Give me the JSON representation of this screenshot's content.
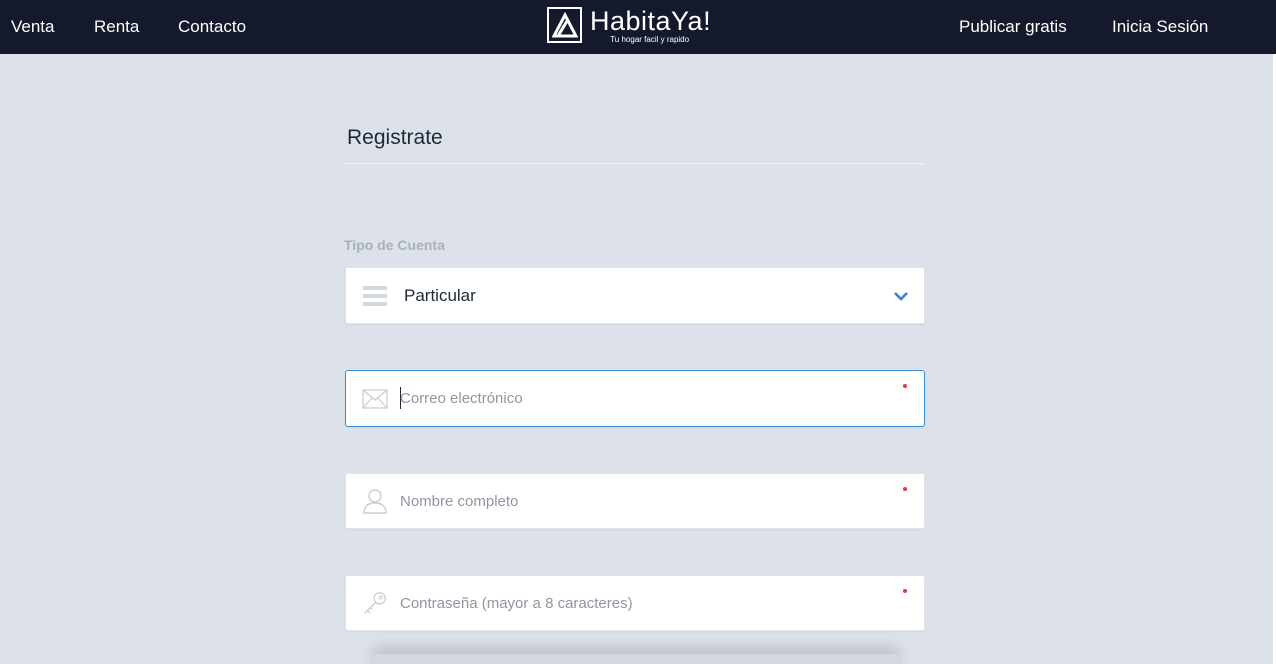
{
  "header": {
    "nav_left": [
      "Venta",
      "Renta",
      "Contacto"
    ],
    "logo": {
      "name": "HabitaYa!",
      "tagline": "Tu hogar facil y rapido"
    },
    "nav_right": {
      "publish": "Publicar gratis",
      "login": "Inicia Sesión"
    }
  },
  "form": {
    "title": "Registrate",
    "account_type": {
      "label": "Tipo de Cuenta",
      "selected": "Particular"
    },
    "email": {
      "placeholder": "Correo electrónico",
      "value": ""
    },
    "name": {
      "placeholder": "Nombre completo",
      "value": ""
    },
    "password": {
      "placeholder": "Contraseña (mayor a 8 caracteres)",
      "value": ""
    }
  },
  "colors": {
    "header_bg": "#141a2c",
    "page_bg": "#dde2ea",
    "accent": "#3a8fd6",
    "required_dot": "#e23b3b"
  },
  "icons": [
    "logo-icon",
    "list-icon",
    "chevron-down-icon",
    "envelope-icon",
    "user-icon",
    "key-icon"
  ]
}
